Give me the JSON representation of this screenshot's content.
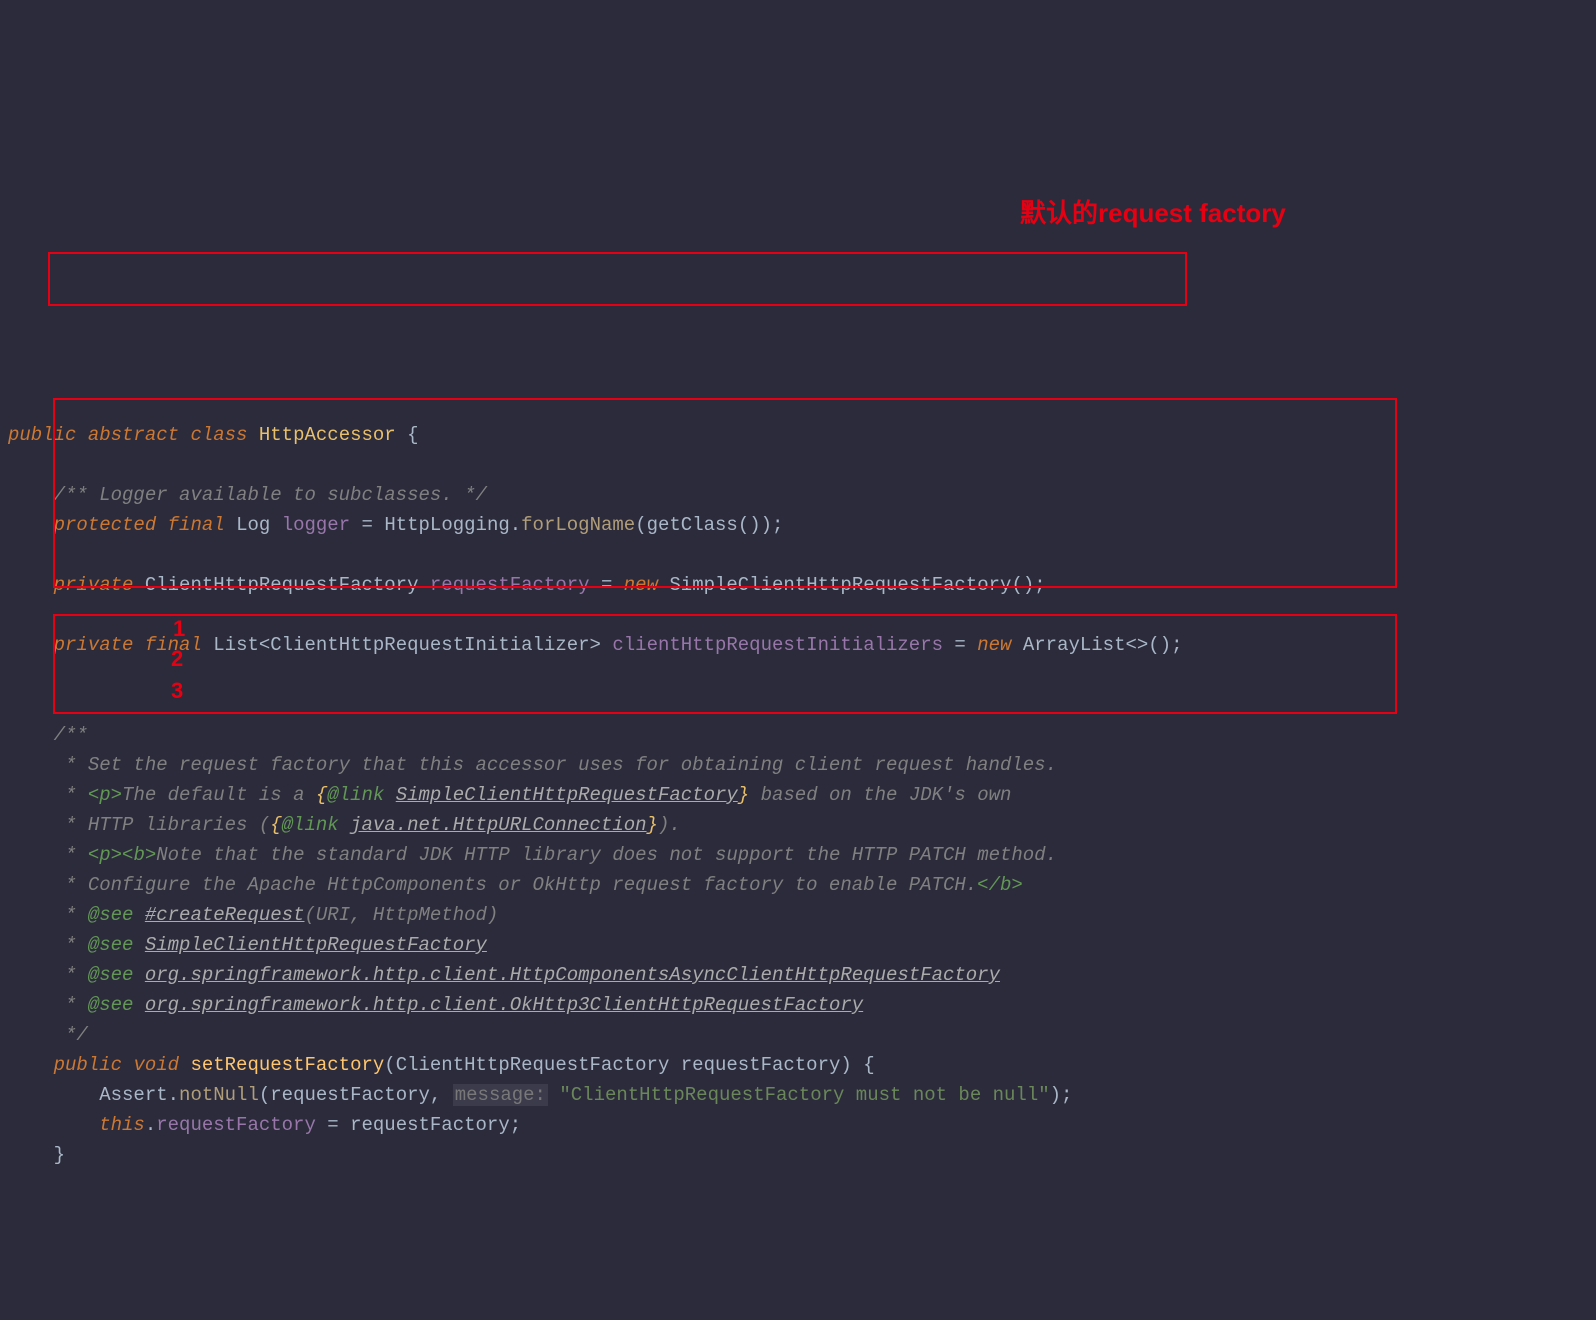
{
  "annotations": {
    "label1": "默认的request factory",
    "num1": "1",
    "num2": "2",
    "num3": "3"
  },
  "code": {
    "l1_public": "public",
    "l1_abstract": "abstract",
    "l1_class": "class",
    "l1_name": "HttpAccessor",
    "l1_brace": " {",
    "l3_comment": "/** Logger available to subclasses. */",
    "l4_protected": "protected",
    "l4_final": "final",
    "l4_Log": "Log",
    "l4_logger": "logger",
    "l4_eq": " = ",
    "l4_HttpLogging": "HttpLogging",
    "l4_dot": ".",
    "l4_forLogName": "forLogName",
    "l4_getClass": "getClass",
    "l4_end": "());",
    "l6_private": "private",
    "l6_type": "ClientHttpRequestFactory",
    "l6_field": "requestFactory",
    "l6_eq": " = ",
    "l6_new": "new",
    "l6_ctor": "SimpleClientHttpRequestFactory",
    "l6_end": "();",
    "l8_private": "private",
    "l8_final": "final",
    "l8_List": "List",
    "l8_lt": "<",
    "l8_gen": "ClientHttpRequestInitializer",
    "l8_gt": ">",
    "l8_field": "clientHttpRequestInitializers",
    "l8_eq": " = ",
    "l8_new": "new",
    "l8_Array": "ArrayList",
    "l8_diamond": "<>();",
    "d1": "/**",
    "d2": " * Set the request factory that this accessor uses for obtaining client request handles.",
    "d3a": " * ",
    "d3_p": "<p>",
    "d3b": "The default is a ",
    "d3_lb": "{",
    "d3_link": "@link",
    "d3_sp": " ",
    "d3_ref": "SimpleClientHttpRequestFactory",
    "d3_rb": "}",
    "d3c": " based on the JDK's own",
    "d4a": " * HTTP libraries (",
    "d4_lb": "{",
    "d4_link": "@link",
    "d4_sp": " ",
    "d4_ref": "java.net.HttpURLConnection",
    "d4_rb": "}",
    "d4b": ").",
    "d5a": " * ",
    "d5_p": "<p>",
    "d5_b": "<b>",
    "d5b": "Note that the standard JDK HTTP library does not support the HTTP PATCH method.",
    "d6a": " * Configure the Apache HttpComponents or OkHttp request factory to enable PATCH.",
    "d6_b": "</b>",
    "d7a": " * ",
    "d7_see": "@see",
    "d7_sp": " ",
    "d7_ref1": "#createRequest",
    "d7_ref2": "(URI, HttpMethod)",
    "d8a": " * ",
    "d8_see": "@see",
    "d8_sp": " ",
    "d8_ref": "SimpleClientHttpRequestFactory",
    "d9a": " * ",
    "d9_see": "@see",
    "d9_sp": " ",
    "d9_ref": "org.springframework.http.client.HttpComponentsAsyncClientHttpRequestFactory",
    "d10a": " * ",
    "d10_see": "@see",
    "d10_sp": " ",
    "d10_ref": "org.springframework.http.client.OkHttp3ClientHttpRequestFactory",
    "d11": " */",
    "m_public": "public",
    "m_void": "void",
    "m_name": "setRequestFactory",
    "m_lp": "(",
    "m_ptype": "ClientHttpRequestFactory",
    "m_pname": "requestFactory",
    "m_rp": ") {",
    "m2_Assert": "Assert",
    "m2_dot": ".",
    "m2_notNull": "notNull",
    "m2_lp": "(",
    "m2_arg1": "requestFactory",
    "m2_comma": ", ",
    "m2_hint": "message:",
    "m2_sp": " ",
    "m2_str": "\"ClientHttpRequestFactory must not be null\"",
    "m2_rp": ");",
    "m3_this": "this",
    "m3_dot": ".",
    "m3_field": "requestFactory",
    "m3_eq": " = ",
    "m3_val": "requestFactory",
    "m3_end": ";",
    "m4_brace": "}"
  }
}
